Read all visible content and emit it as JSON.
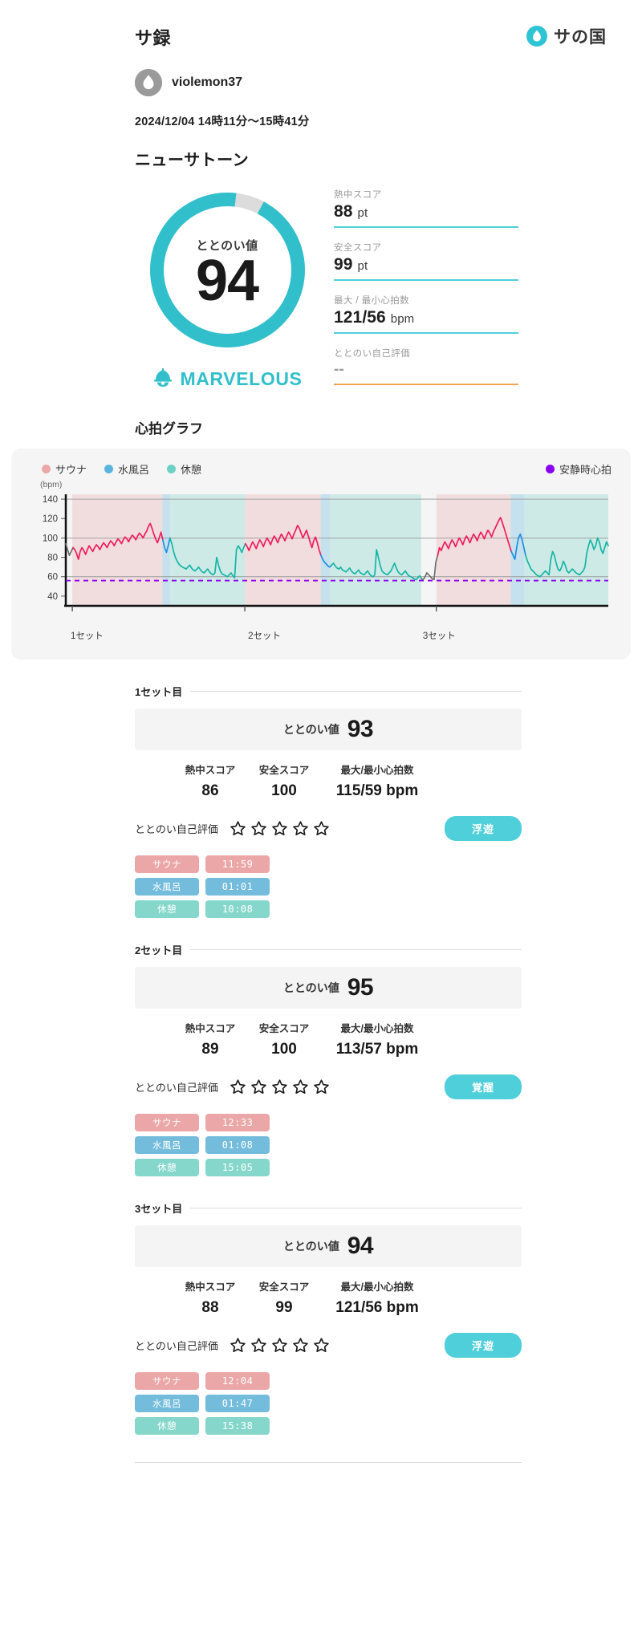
{
  "header": {
    "app_title": "サ録",
    "brand_text": "サの国",
    "brand_icon": "water-drop-icon"
  },
  "user": {
    "name": "violemon37",
    "avatar_icon": "water-drop-avatar-icon"
  },
  "session": {
    "datetime": "2024/12/04 14時11分〜15時41分",
    "venue": "ニューサトーン"
  },
  "summary": {
    "gauge_label": "ととのい値",
    "gauge_value": "94",
    "gauge_percent": 94,
    "rank_text": "MARVELOUS",
    "rank_icon": "sauna-bell-icon",
    "accent_color": "#31c0cb",
    "stats": [
      {
        "label": "熱中スコア",
        "value": "88",
        "unit": "pt",
        "rule_color": "#4ed0dc"
      },
      {
        "label": "安全スコア",
        "value": "99",
        "unit": "pt",
        "rule_color": "#4ed0dc"
      },
      {
        "label": "最大 / 最小心拍数",
        "value": "121/56",
        "unit": "bpm",
        "rule_color": "#4ed0dc"
      },
      {
        "label": "ととのい自己評価",
        "value": "--",
        "unit": "",
        "rule_color": "#f0a350"
      }
    ]
  },
  "chart": {
    "title": "心拍グラフ",
    "legend": [
      {
        "label": "サウナ",
        "color": "#eba7a8"
      },
      {
        "label": "水風呂",
        "color": "#5ab4de"
      },
      {
        "label": "休憩",
        "color": "#6fd0c6"
      }
    ],
    "legend_right": {
      "label": "安静時心拍",
      "color": "#8a00f0"
    }
  },
  "chart_data": {
    "type": "line",
    "title": "心拍グラフ",
    "xlabel": "",
    "ylabel": "(bpm)",
    "ylim": [
      30,
      145
    ],
    "yticks": [
      40,
      60,
      80,
      100,
      120,
      140
    ],
    "xticks": [
      0,
      1,
      2
    ],
    "xticklabels": [
      "1セット",
      "2セット",
      "3セット"
    ],
    "grid": true,
    "legend": [
      "サウナ",
      "水風呂",
      "休憩",
      "安静時心拍"
    ],
    "resting_hr": 56,
    "annotations": [
      {
        "text": "安静時心拍",
        "value": 56,
        "color": "#8a00f0",
        "style": "dashed-hline"
      }
    ],
    "phases": [
      {
        "name": "サウナ",
        "set": 1,
        "color": "#eba7a8",
        "x_start": 0.012,
        "x_end": 0.178,
        "duration": "11:59",
        "max_bpm": 115
      },
      {
        "name": "水風呂",
        "set": 1,
        "color": "#5ab4de",
        "x_start": 0.178,
        "x_end": 0.192,
        "duration": "01:01"
      },
      {
        "name": "休憩",
        "set": 1,
        "color": "#6fd0c6",
        "x_start": 0.192,
        "x_end": 0.33,
        "duration": "10:08",
        "min_bpm": 59
      },
      {
        "name": "サウナ",
        "set": 2,
        "color": "#eba7a8",
        "x_start": 0.33,
        "x_end": 0.47,
        "duration": "12:33",
        "max_bpm": 113
      },
      {
        "name": "水風呂",
        "set": 2,
        "color": "#5ab4de",
        "x_start": 0.47,
        "x_end": 0.487,
        "duration": "01:08"
      },
      {
        "name": "休憩",
        "set": 2,
        "color": "#6fd0c6",
        "x_start": 0.487,
        "x_end": 0.655,
        "duration": "15:05",
        "min_bpm": 57
      },
      {
        "name": "サウナ",
        "set": 3,
        "color": "#eba7a8",
        "x_start": 0.683,
        "x_end": 0.82,
        "duration": "12:04",
        "max_bpm": 121
      },
      {
        "name": "水風呂",
        "set": 3,
        "color": "#5ab4de",
        "x_start": 0.82,
        "x_end": 0.845,
        "duration": "01:47"
      },
      {
        "name": "休憩",
        "set": 3,
        "color": "#6fd0c6",
        "x_start": 0.845,
        "x_end": 1.0,
        "duration": "15:38",
        "min_bpm": 56
      }
    ],
    "series": [
      {
        "name": "心拍数",
        "unit": "bpm",
        "values": [
          94,
          88,
          82,
          86,
          90,
          88,
          84,
          78,
          86,
          90,
          87,
          83,
          88,
          92,
          89,
          86,
          90,
          93,
          91,
          88,
          92,
          95,
          93,
          90,
          94,
          97,
          95,
          92,
          96,
          99,
          97,
          94,
          98,
          101,
          99,
          96,
          100,
          103,
          101,
          98,
          102,
          105,
          103,
          100,
          104,
          107,
          112,
          115,
          110,
          104,
          99,
          95,
          100,
          106,
          98,
          90,
          85,
          92,
          100,
          94,
          86,
          80,
          76,
          73,
          71,
          70,
          69,
          68,
          70,
          72,
          69,
          67,
          66,
          68,
          70,
          67,
          65,
          64,
          66,
          68,
          65,
          63,
          62,
          64,
          80,
          72,
          66,
          63,
          62,
          61,
          60,
          62,
          64,
          61,
          59,
          88,
          92,
          89,
          85,
          90,
          94,
          91,
          87,
          92,
          96,
          93,
          89,
          94,
          98,
          95,
          91,
          96,
          100,
          97,
          93,
          98,
          102,
          99,
          95,
          100,
          104,
          101,
          97,
          102,
          106,
          103,
          99,
          104,
          108,
          113,
          110,
          105,
          100,
          104,
          108,
          102,
          96,
          90,
          97,
          101,
          95,
          88,
          82,
          78,
          75,
          73,
          71,
          70,
          72,
          74,
          71,
          69,
          68,
          70,
          67,
          66,
          65,
          67,
          69,
          66,
          64,
          63,
          65,
          67,
          64,
          63,
          62,
          64,
          66,
          63,
          61,
          60,
          62,
          88,
          80,
          72,
          66,
          64,
          63,
          62,
          64,
          66,
          70,
          74,
          69,
          65,
          63,
          62,
          64,
          66,
          63,
          61,
          60,
          59,
          58,
          57,
          59,
          61,
          58,
          57,
          60,
          64,
          62,
          60,
          58,
          57,
          75,
          82,
          90,
          87,
          92,
          96,
          93,
          89,
          94,
          98,
          95,
          91,
          96,
          100,
          97,
          93,
          98,
          102,
          99,
          95,
          100,
          104,
          101,
          97,
          102,
          106,
          103,
          99,
          104,
          108,
          105,
          101,
          106,
          110,
          114,
          118,
          121,
          116,
          110,
          104,
          98,
          92,
          86,
          82,
          78,
          90,
          100,
          104,
          98,
          90,
          82,
          76,
          72,
          68,
          66,
          64,
          62,
          61,
          60,
          62,
          64,
          66,
          64,
          62,
          78,
          86,
          82,
          74,
          68,
          66,
          70,
          76,
          72,
          66,
          64,
          66,
          68,
          66,
          64,
          63,
          62,
          64,
          66,
          70,
          84,
          92,
          98,
          94,
          88,
          92,
          100,
          96,
          88,
          84,
          90,
          96,
          92
        ]
      }
    ]
  },
  "sets": [
    {
      "head_label": "1セット目",
      "banner_label": "ととのい値",
      "banner_value": "93",
      "stats": [
        {
          "label": "熱中スコア",
          "value": "86"
        },
        {
          "label": "安全スコア",
          "value": "100"
        },
        {
          "label": "最大/最小心拍数",
          "value": "115/59 bpm"
        }
      ],
      "rating_label": "ととのい自己評価",
      "rating_stars": 5,
      "rating_filled": 0,
      "mood_chip": "浮遊",
      "chips": [
        {
          "kind": "サウナ",
          "time": "11:59",
          "class": "sauna"
        },
        {
          "kind": "水風呂",
          "time": "01:01",
          "class": "bath"
        },
        {
          "kind": "休憩",
          "time": "10:08",
          "class": "rest"
        }
      ]
    },
    {
      "head_label": "2セット目",
      "banner_label": "ととのい値",
      "banner_value": "95",
      "stats": [
        {
          "label": "熱中スコア",
          "value": "89"
        },
        {
          "label": "安全スコア",
          "value": "100"
        },
        {
          "label": "最大/最小心拍数",
          "value": "113/57 bpm"
        }
      ],
      "rating_label": "ととのい自己評価",
      "rating_stars": 5,
      "rating_filled": 0,
      "mood_chip": "覚醒",
      "chips": [
        {
          "kind": "サウナ",
          "time": "12:33",
          "class": "sauna"
        },
        {
          "kind": "水風呂",
          "time": "01:08",
          "class": "bath"
        },
        {
          "kind": "休憩",
          "time": "15:05",
          "class": "rest"
        }
      ]
    },
    {
      "head_label": "3セット目",
      "banner_label": "ととのい値",
      "banner_value": "94",
      "stats": [
        {
          "label": "熱中スコア",
          "value": "88"
        },
        {
          "label": "安全スコア",
          "value": "99"
        },
        {
          "label": "最大/最小心拍数",
          "value": "121/56 bpm"
        }
      ],
      "rating_label": "ととのい自己評価",
      "rating_stars": 5,
      "rating_filled": 0,
      "mood_chip": "浮遊",
      "chips": [
        {
          "kind": "サウナ",
          "time": "12:04",
          "class": "sauna"
        },
        {
          "kind": "水風呂",
          "time": "01:47",
          "class": "bath"
        },
        {
          "kind": "休憩",
          "time": "15:38",
          "class": "rest"
        }
      ]
    }
  ]
}
